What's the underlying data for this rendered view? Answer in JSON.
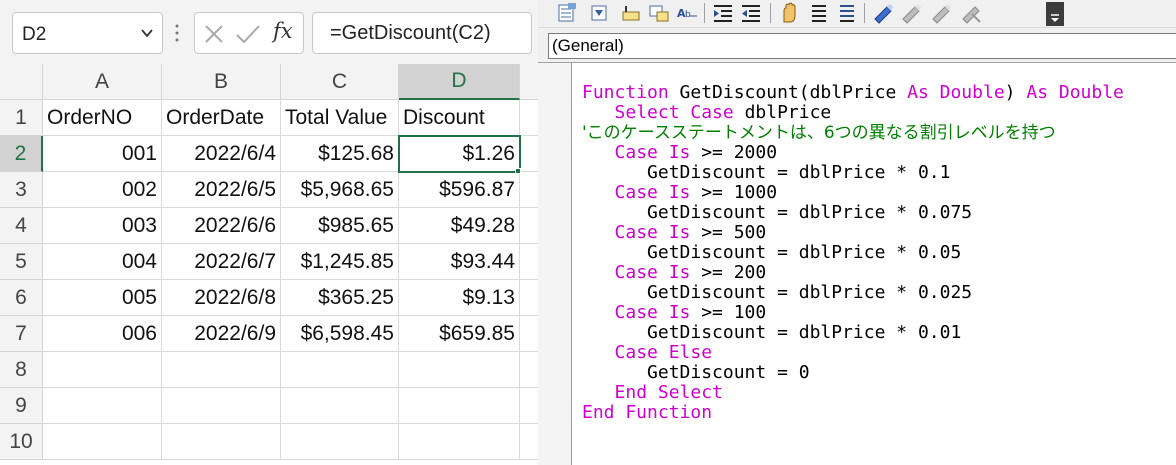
{
  "name_box": {
    "value": "D2"
  },
  "formula_bar": {
    "formula": "=GetDiscount(C2)",
    "fx_label": "fx"
  },
  "columns": [
    "A",
    "B",
    "C",
    "D"
  ],
  "row_numbers": [
    "1",
    "2",
    "3",
    "4",
    "5",
    "6",
    "7",
    "8",
    "9",
    "10"
  ],
  "selected_cell": {
    "column": "D",
    "row": "2"
  },
  "rows": [
    [
      "OrderNO",
      "OrderDate",
      "Total Value",
      "Discount"
    ],
    [
      "001",
      "2022/6/4",
      "$125.68",
      "$1.26"
    ],
    [
      "002",
      "2022/6/5",
      "$5,968.65",
      "$596.87"
    ],
    [
      "003",
      "2022/6/6",
      "$985.65",
      "$49.28"
    ],
    [
      "004",
      "2022/6/7",
      "$1,245.85",
      "$93.44"
    ],
    [
      "005",
      "2022/6/8",
      "$365.25",
      "$9.13"
    ],
    [
      "006",
      "2022/6/9",
      "$6,598.45",
      "$659.85"
    ],
    [
      "",
      "",
      "",
      ""
    ],
    [
      "",
      "",
      "",
      ""
    ],
    [
      "",
      "",
      "",
      ""
    ]
  ],
  "vbe": {
    "procedure_dropdown": "(General)",
    "toolbar_icons": [
      "list-properties-icon",
      "list-constants-icon",
      "quick-info-icon",
      "parameter-info-icon",
      "complete-word-icon",
      "indent-icon",
      "outdent-icon",
      "toggle-breakpoint-icon",
      "comment-block-icon",
      "uncomment-block-icon",
      "toggle-bookmark-icon",
      "next-bookmark-icon",
      "previous-bookmark-icon",
      "clear-bookmarks-icon",
      "toolbar-options-icon"
    ],
    "colors": {
      "keyword": "#d000d0",
      "comment": "#008000",
      "plain": "#000000"
    },
    "code_lines": [
      [
        [
          "kw",
          "Function"
        ],
        [
          "",
          " GetDiscount(dblPrice "
        ],
        [
          "kw",
          "As Double"
        ],
        [
          "",
          ") "
        ],
        [
          "kw",
          "As Double"
        ]
      ],
      [
        [
          "",
          "   "
        ],
        [
          "kw",
          "Select Case"
        ],
        [
          "",
          " dblPrice"
        ]
      ],
      [
        [
          "cm",
          "'このケースステートメントは、6つの異なる割引レベルを持つ"
        ]
      ],
      [
        [
          "",
          "   "
        ],
        [
          "kw",
          "Case Is"
        ],
        [
          "",
          " >= 2000"
        ]
      ],
      [
        [
          "",
          "      GetDiscount = dblPrice * 0.1"
        ]
      ],
      [
        [
          "",
          "   "
        ],
        [
          "kw",
          "Case Is"
        ],
        [
          "",
          " >= 1000"
        ]
      ],
      [
        [
          "",
          "      GetDiscount = dblPrice * 0.075"
        ]
      ],
      [
        [
          "",
          "   "
        ],
        [
          "kw",
          "Case Is"
        ],
        [
          "",
          " >= 500"
        ]
      ],
      [
        [
          "",
          "      GetDiscount = dblPrice * 0.05"
        ]
      ],
      [
        [
          "",
          "   "
        ],
        [
          "kw",
          "Case Is"
        ],
        [
          "",
          " >= 200"
        ]
      ],
      [
        [
          "",
          "      GetDiscount = dblPrice * 0.025"
        ]
      ],
      [
        [
          "",
          "   "
        ],
        [
          "kw",
          "Case Is"
        ],
        [
          "",
          " >= 100"
        ]
      ],
      [
        [
          "",
          "      GetDiscount = dblPrice * 0.01"
        ]
      ],
      [
        [
          "",
          "   "
        ],
        [
          "kw",
          "Case Else"
        ]
      ],
      [
        [
          "",
          "      GetDiscount = 0"
        ]
      ],
      [
        [
          "",
          "   "
        ],
        [
          "kw",
          "End Select"
        ]
      ],
      [
        [
          "kw",
          "End Function"
        ]
      ]
    ]
  }
}
